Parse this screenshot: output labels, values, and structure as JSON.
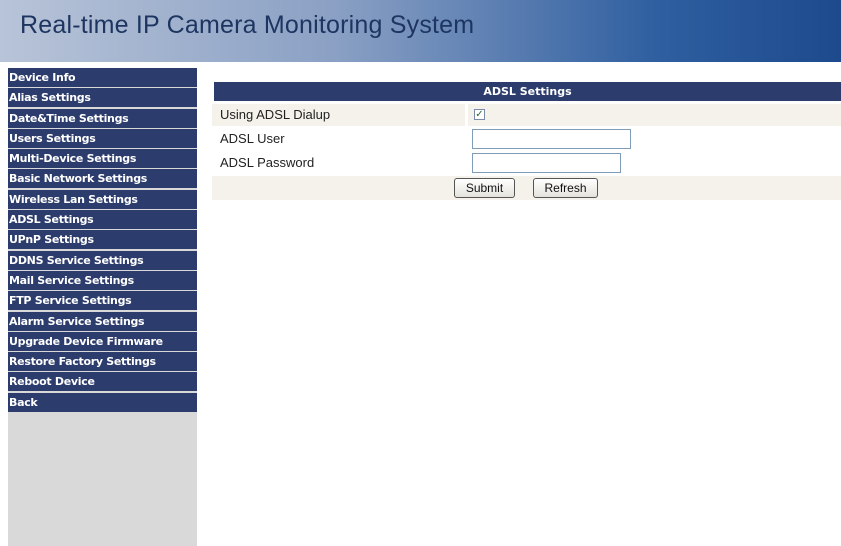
{
  "header": {
    "title": "Real-time IP Camera Monitoring System"
  },
  "sidebar": {
    "items": [
      {
        "label": "Device Info"
      },
      {
        "label": "Alias Settings"
      },
      {
        "label": "Date&Time Settings"
      },
      {
        "label": "Users Settings"
      },
      {
        "label": "Multi-Device Settings"
      },
      {
        "label": "Basic Network Settings"
      },
      {
        "label": "Wireless Lan Settings"
      },
      {
        "label": "ADSL Settings"
      },
      {
        "label": "UPnP Settings"
      },
      {
        "label": "DDNS Service Settings"
      },
      {
        "label": "Mail Service Settings"
      },
      {
        "label": "FTP Service Settings"
      },
      {
        "label": "Alarm Service Settings"
      },
      {
        "label": "Upgrade Device Firmware"
      },
      {
        "label": "Restore Factory Settings"
      },
      {
        "label": "Reboot Device"
      },
      {
        "label": "Back"
      }
    ]
  },
  "form": {
    "section_title": "ADSL Settings",
    "dialup_label": "Using ADSL Dialup",
    "dialup_checked": true,
    "user_label": "ADSL User",
    "user_value": "",
    "password_label": "ADSL Password",
    "password_value": "",
    "submit_label": "Submit",
    "refresh_label": "Refresh"
  },
  "colors": {
    "nav_bg": "#2c3c6c",
    "row_bg": "#f4f2ea",
    "sidebar_bg": "#d9d9d9"
  }
}
